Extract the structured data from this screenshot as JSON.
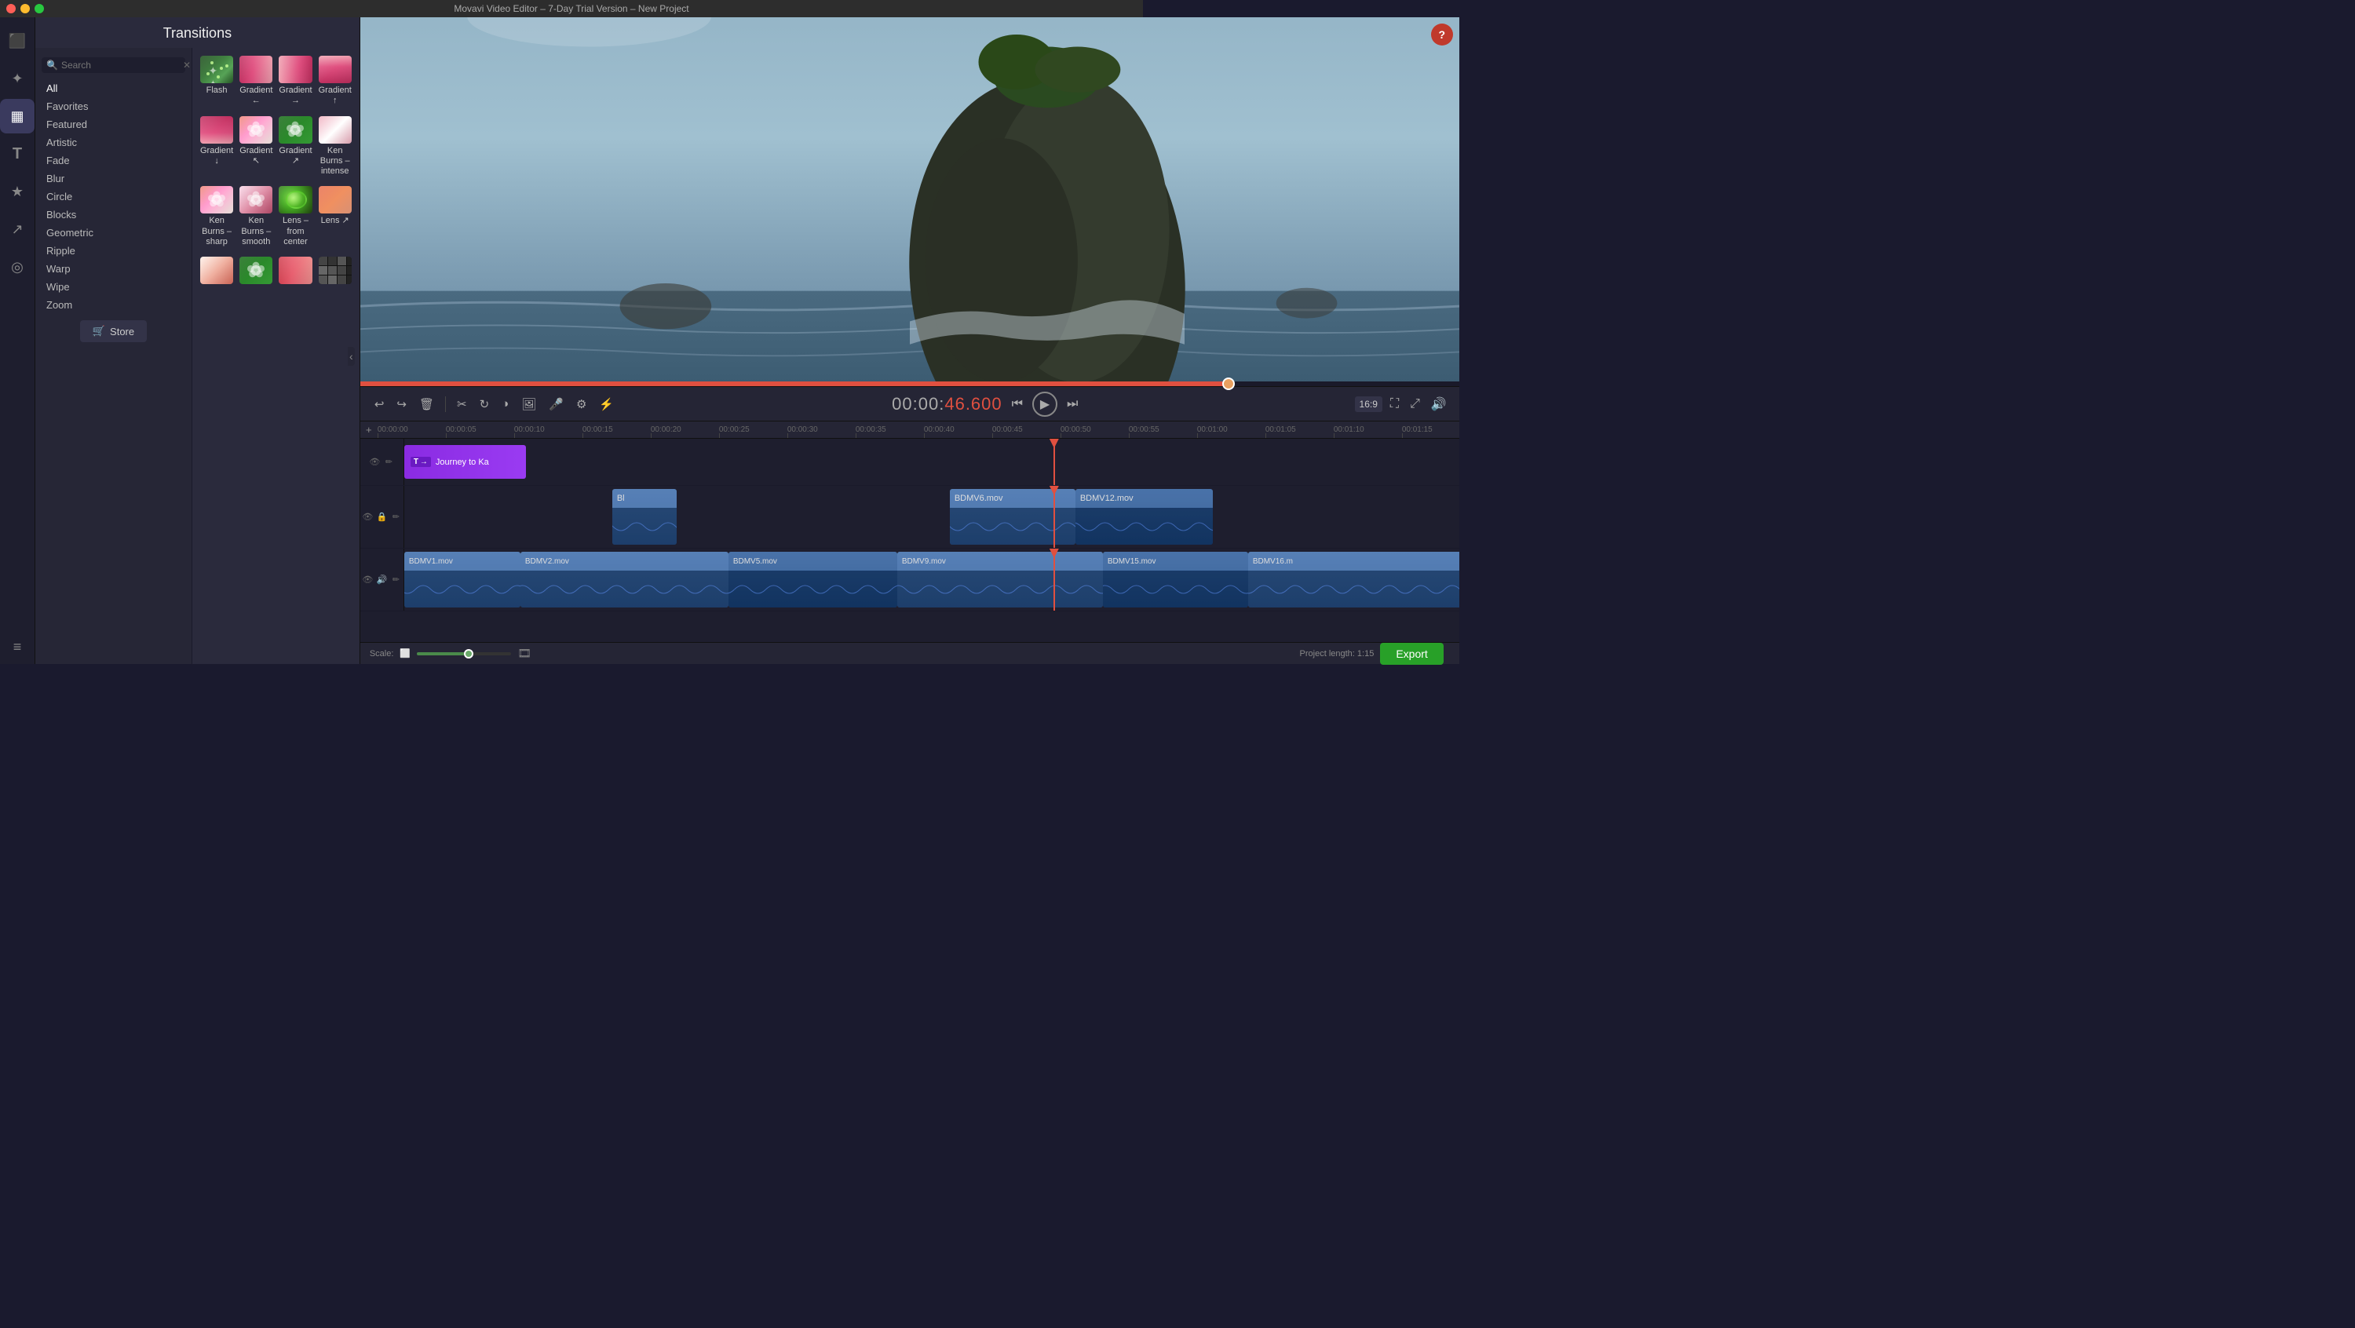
{
  "titlebar": {
    "title": "Movavi Video Editor – 7-Day Trial Version – New Project"
  },
  "transitions_panel": {
    "title": "Transitions",
    "search_placeholder": "Search",
    "categories": [
      {
        "id": "all",
        "label": "All",
        "active": true
      },
      {
        "id": "favorites",
        "label": "Favorites"
      },
      {
        "id": "featured",
        "label": "Featured"
      },
      {
        "id": "artistic",
        "label": "Artistic"
      },
      {
        "id": "fade",
        "label": "Fade"
      },
      {
        "id": "blur",
        "label": "Blur"
      },
      {
        "id": "circle",
        "label": "Circle"
      },
      {
        "id": "blocks",
        "label": "Blocks"
      },
      {
        "id": "geometric",
        "label": "Geometric"
      },
      {
        "id": "ripple",
        "label": "Ripple"
      },
      {
        "id": "warp",
        "label": "Warp"
      },
      {
        "id": "wipe",
        "label": "Wipe"
      },
      {
        "id": "zoom",
        "label": "Zoom"
      }
    ],
    "store_label": "Store",
    "transitions": [
      {
        "id": "flash",
        "label": "Flash",
        "thumb": "flash"
      },
      {
        "id": "gradient-left",
        "label": "Gradient ←",
        "thumb": "grad-left"
      },
      {
        "id": "gradient-right",
        "label": "Gradient →",
        "thumb": "grad-right"
      },
      {
        "id": "gradient-up",
        "label": "Gradient ↑",
        "thumb": "grad-up"
      },
      {
        "id": "gradient-down",
        "label": "Gradient ↓",
        "thumb": "grad-down"
      },
      {
        "id": "gradient-tl",
        "label": "Gradient ↖",
        "thumb": "flower"
      },
      {
        "id": "gradient-tr",
        "label": "Gradient ↗",
        "thumb": "flower"
      },
      {
        "id": "ken-burns-intense",
        "label": "Ken Burns – intense",
        "thumb": "ken-intense"
      },
      {
        "id": "ken-burns-sharp",
        "label": "Ken Burns – sharp",
        "thumb": "ken-sharp"
      },
      {
        "id": "ken-burns-smooth",
        "label": "Ken Burns – smooth",
        "thumb": "ken-smooth"
      },
      {
        "id": "lens-center",
        "label": "Lens – from center",
        "thumb": "lens-center"
      },
      {
        "id": "lens-diag",
        "label": "Lens ↗",
        "thumb": "lens-diag"
      },
      {
        "id": "partial1",
        "label": "",
        "thumb": "partial1"
      },
      {
        "id": "partial2",
        "label": "",
        "thumb": "partial2"
      },
      {
        "id": "partial3",
        "label": "",
        "thumb": "partial3"
      },
      {
        "id": "partial4",
        "label": "",
        "thumb": "partial4"
      }
    ]
  },
  "toolbar": {
    "undo_label": "↩",
    "redo_label": "↪",
    "delete_label": "🗑",
    "cut_label": "✂",
    "rotate_label": "↻",
    "color_label": "◑",
    "image_label": "🖼",
    "audio_label": "🎤",
    "settings_label": "⚙",
    "adjust_label": "⚡"
  },
  "transport": {
    "timecode": "00:00:",
    "timecode_end": "46.600",
    "prev_label": "⏮",
    "play_label": "▶",
    "next_label": "⏭",
    "ratio_label": "16:9",
    "fullscreen_label": "⛶",
    "expand_label": "⤢",
    "volume_label": "🔊"
  },
  "timeline": {
    "add_track_label": "+",
    "ruler_ticks": [
      "00:00:00",
      "00:00:05",
      "00:00:10",
      "00:00:15",
      "00:00:20",
      "00:00:25",
      "00:00:30",
      "00:00:35",
      "00:00:40",
      "00:00:45",
      "00:00:50",
      "00:00:55",
      "00:01:00",
      "00:01:05",
      "00:01:10",
      "00:01:15"
    ],
    "tracks": [
      {
        "id": "text-track",
        "type": "text",
        "clips": [
          {
            "label": "Journey to Ka",
            "start_pct": 0,
            "width_pct": 10
          }
        ]
      },
      {
        "id": "video-track-2",
        "type": "video",
        "clips": [
          {
            "label": "Bl",
            "start_pct": 17,
            "width_pct": 6
          },
          {
            "label": "BDMV6.mov",
            "start_pct": 45,
            "width_pct": 11
          },
          {
            "label": "BDMV12.mov",
            "start_pct": 56,
            "width_pct": 12
          }
        ]
      },
      {
        "id": "video-track-1",
        "type": "video",
        "clips": [
          {
            "label": "BDMV1.mov",
            "start_pct": 0,
            "width_pct": 10
          },
          {
            "label": "BDMV2.mov",
            "start_pct": 10,
            "width_pct": 20
          },
          {
            "label": "BDMV5.mov",
            "start_pct": 30,
            "width_pct": 15
          },
          {
            "label": "BDMV9.mov",
            "start_pct": 45,
            "width_pct": 20
          },
          {
            "label": "BDMV15.mov",
            "start_pct": 65,
            "width_pct": 12
          },
          {
            "label": "BDMV16.m",
            "start_pct": 77,
            "width_pct": 23
          }
        ]
      }
    ],
    "playhead_pct": 59
  },
  "scale": {
    "label": "Scale:",
    "fill_pct": 55,
    "thumb_pct": 55,
    "project_length_label": "Project length:",
    "project_length": "1:15"
  },
  "export": {
    "label": "Export"
  }
}
